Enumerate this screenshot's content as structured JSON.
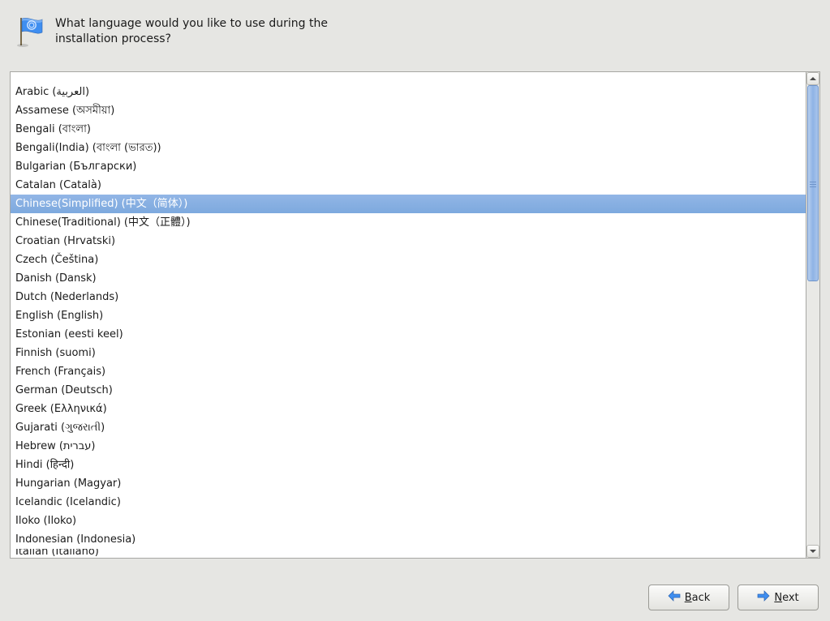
{
  "header": {
    "prompt": "What language would you like to use during the installation process?"
  },
  "languages": {
    "cut_top": "",
    "items": [
      {
        "label": "Arabic (العربية)",
        "selected": false
      },
      {
        "label": "Assamese (অসমীয়া)",
        "selected": false
      },
      {
        "label": "Bengali (বাংলা)",
        "selected": false
      },
      {
        "label": "Bengali(India) (বাংলা (ভারত))",
        "selected": false
      },
      {
        "label": "Bulgarian (Български)",
        "selected": false
      },
      {
        "label": "Catalan (Català)",
        "selected": false
      },
      {
        "label": "Chinese(Simplified) (中文（简体）)",
        "selected": true
      },
      {
        "label": "Chinese(Traditional) (中文（正體）)",
        "selected": false
      },
      {
        "label": "Croatian (Hrvatski)",
        "selected": false
      },
      {
        "label": "Czech (Čeština)",
        "selected": false
      },
      {
        "label": "Danish (Dansk)",
        "selected": false
      },
      {
        "label": "Dutch (Nederlands)",
        "selected": false
      },
      {
        "label": "English (English)",
        "selected": false
      },
      {
        "label": "Estonian (eesti keel)",
        "selected": false
      },
      {
        "label": "Finnish (suomi)",
        "selected": false
      },
      {
        "label": "French (Français)",
        "selected": false
      },
      {
        "label": "German (Deutsch)",
        "selected": false
      },
      {
        "label": "Greek (Ελληνικά)",
        "selected": false
      },
      {
        "label": "Gujarati (ગુજરાતી)",
        "selected": false
      },
      {
        "label": "Hebrew (עברית)",
        "selected": false
      },
      {
        "label": "Hindi (हिन्दी)",
        "selected": false
      },
      {
        "label": "Hungarian (Magyar)",
        "selected": false
      },
      {
        "label": "Icelandic (Icelandic)",
        "selected": false
      },
      {
        "label": "Iloko (Iloko)",
        "selected": false
      },
      {
        "label": "Indonesian (Indonesia)",
        "selected": false
      }
    ],
    "cut_bottom": "Italian (Italiano)"
  },
  "footer": {
    "back_label": "Back",
    "next_label": "Next"
  }
}
